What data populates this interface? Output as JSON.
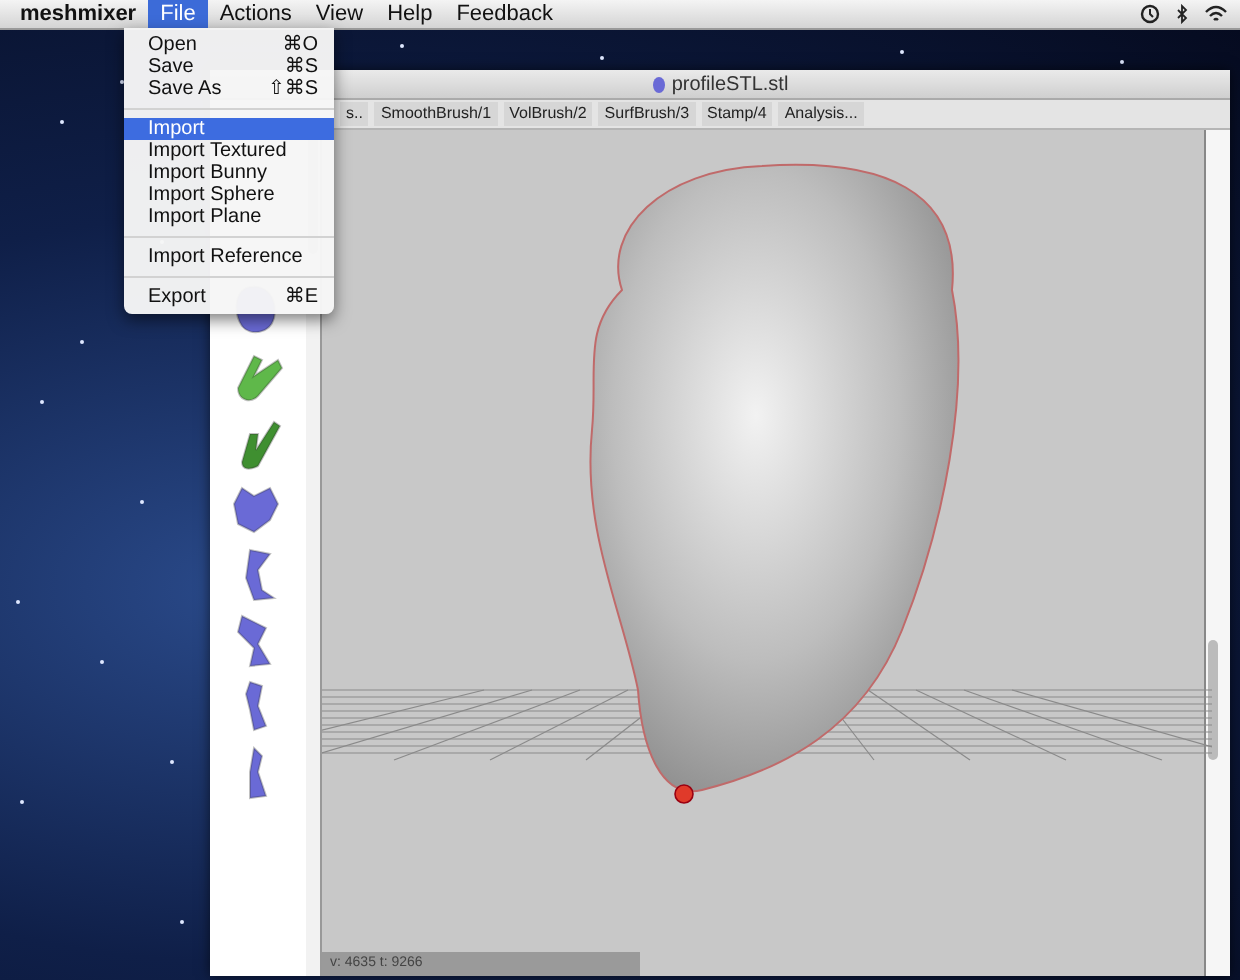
{
  "menu_bar": {
    "app": "meshmixer",
    "items": [
      {
        "label": "File",
        "selected": true
      },
      {
        "label": "Actions",
        "selected": false
      },
      {
        "label": "View",
        "selected": false
      },
      {
        "label": "Help",
        "selected": false
      },
      {
        "label": "Feedback",
        "selected": false
      }
    ]
  },
  "file_menu": {
    "items": [
      {
        "kind": "item",
        "label": "Open",
        "shortcut": "⌘O",
        "selected": false
      },
      {
        "kind": "item",
        "label": "Save",
        "shortcut": "⌘S",
        "selected": false
      },
      {
        "kind": "item",
        "label": "Save As",
        "shortcut": "⇧⌘S",
        "selected": false
      },
      {
        "kind": "separator"
      },
      {
        "kind": "item",
        "label": "Import",
        "selected": true
      },
      {
        "kind": "item",
        "label": "Import Textured",
        "selected": false
      },
      {
        "kind": "item",
        "label": "Import Bunny",
        "selected": false
      },
      {
        "kind": "item",
        "label": "Import Sphere",
        "selected": false
      },
      {
        "kind": "item",
        "label": "Import Plane",
        "selected": false
      },
      {
        "kind": "separator"
      },
      {
        "kind": "item",
        "label": "Import Reference",
        "selected": false
      },
      {
        "kind": "separator"
      },
      {
        "kind": "item",
        "label": "Export",
        "shortcut": "⌘E",
        "selected": false
      }
    ]
  },
  "window": {
    "title": "profileSTL.stl"
  },
  "toolbar": {
    "buttons": [
      "s..",
      "SmoothBrush/1",
      "VolBrush/2",
      "SurfBrush/3",
      "Stamp/4",
      "Analysis..."
    ]
  },
  "status_bar": {
    "text": "v: 4635 t: 9266"
  }
}
